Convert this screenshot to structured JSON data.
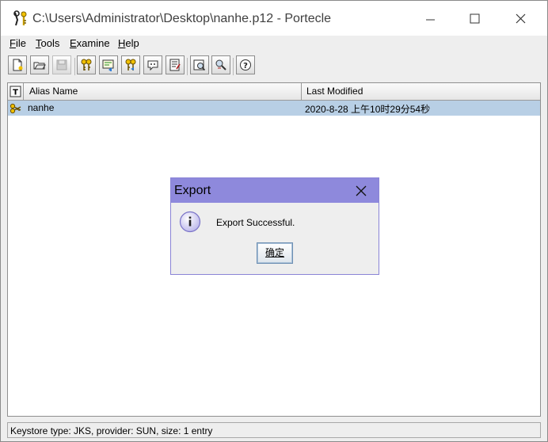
{
  "window": {
    "title": "C:\\Users\\Administrator\\Desktop\\nanhe.p12 - Portecle"
  },
  "menubar": {
    "items": [
      "File",
      "Tools",
      "Examine",
      "Help"
    ]
  },
  "toolbar": {
    "buttons": [
      "new-keystore-icon",
      "open-keystore-icon",
      "save-keystore-icon",
      "generate-keypair-icon",
      "import-trusted-cert-icon",
      "import-keypair-icon",
      "examine-cert-icon",
      "examine-crl-icon",
      "keystore-report-icon",
      "keystore-properties-icon",
      "help-icon"
    ]
  },
  "table": {
    "columns": {
      "type": "T",
      "alias": "Alias Name",
      "modified": "Last Modified"
    },
    "rows": [
      {
        "alias": "nanhe",
        "modified": "2020-8-28 上午10时29分54秒"
      }
    ]
  },
  "status": {
    "text": "Keystore type: JKS, provider: SUN, size: 1 entry"
  },
  "dialog": {
    "title": "Export",
    "message": "Export Successful.",
    "ok_label": "确定"
  }
}
